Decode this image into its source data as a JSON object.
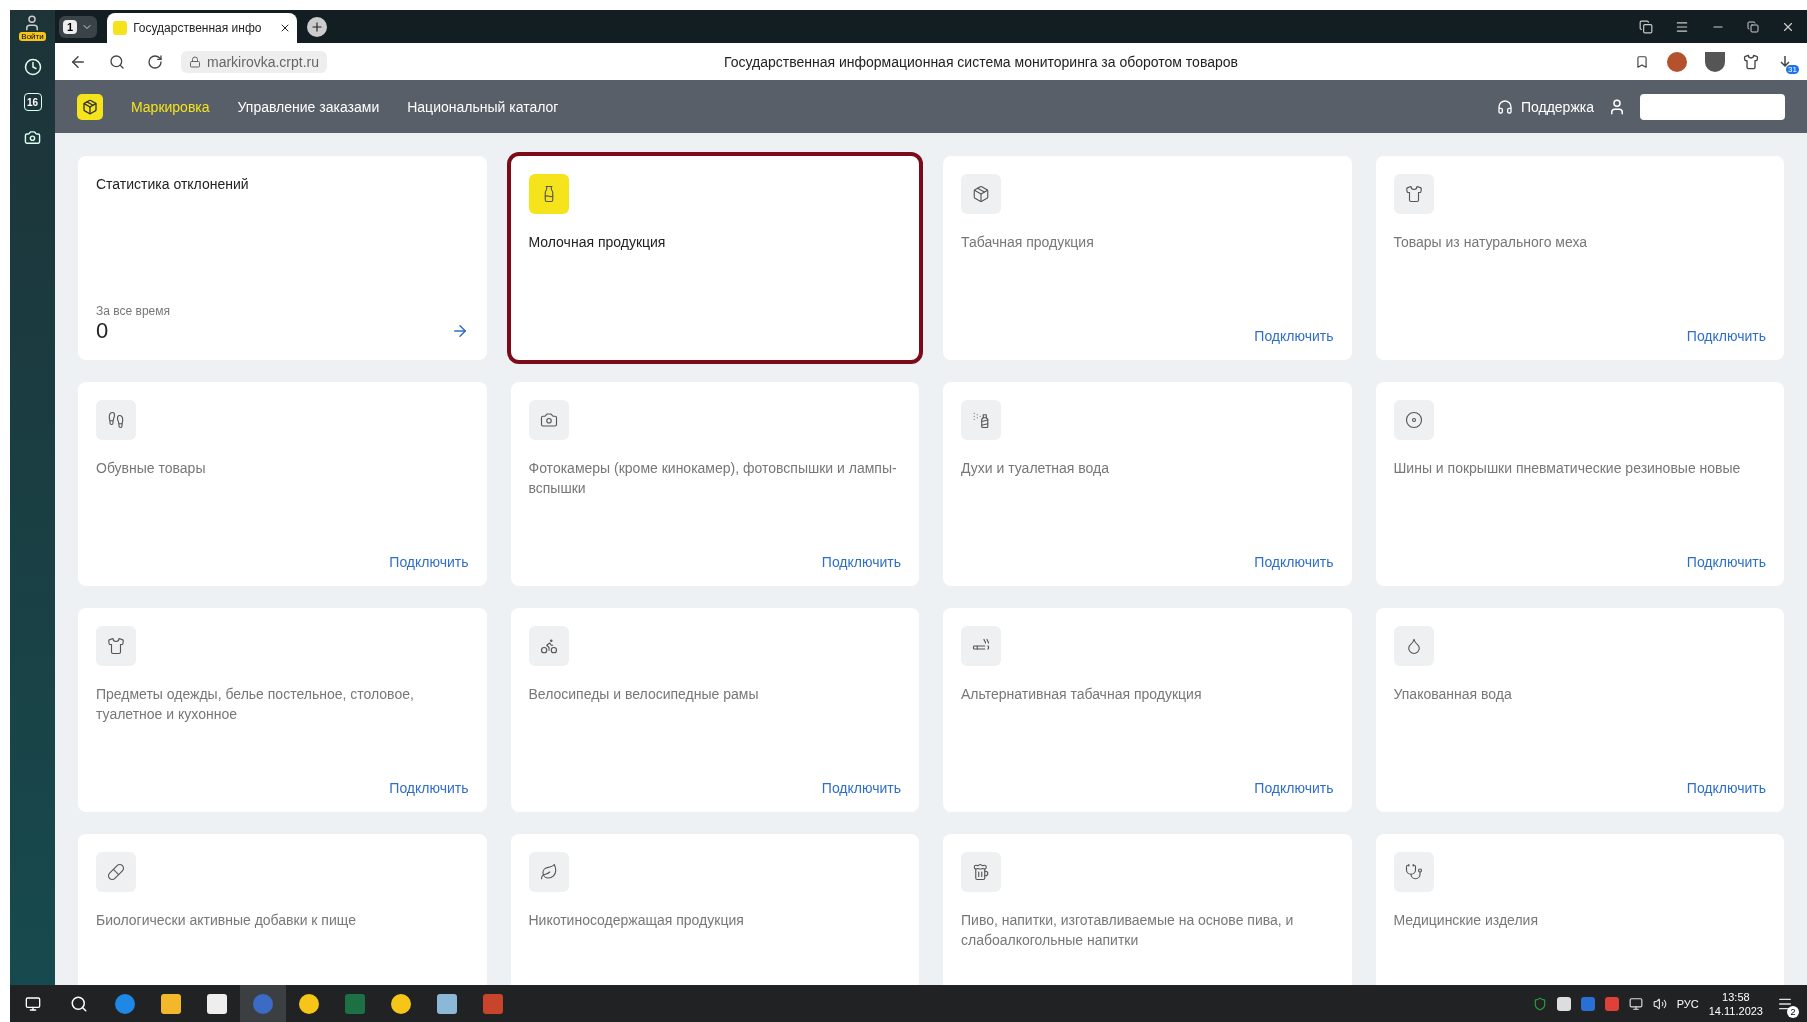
{
  "browser": {
    "profile_label": "Войти",
    "tab_count": "1",
    "tabs": [
      {
        "title": "Государственная инфо",
        "selected": true
      }
    ],
    "address": "markirovka.crpt.ru",
    "page_title": "Государственная информационная система мониторинга за оборотом товаров",
    "sidebar_badge": "16",
    "extension_badge": "31"
  },
  "header": {
    "nav": [
      {
        "label": "Маркировка",
        "selected": true
      },
      {
        "label": "Управление заказами",
        "selected": false
      },
      {
        "label": "Национальный каталог",
        "selected": false
      }
    ],
    "support": "Поддержка"
  },
  "cards": [
    {
      "kind": "stats",
      "title": "Статистика отклонений",
      "caption": "За все время",
      "value": "0"
    },
    {
      "kind": "product",
      "title": "Молочная продукция",
      "selected": true
    },
    {
      "kind": "product",
      "title": "Табачная продукция",
      "selected": false,
      "action": "Подключить"
    },
    {
      "kind": "product",
      "title": "Товары из натурального меха",
      "selected": false,
      "action": "Подключить"
    },
    {
      "kind": "product",
      "title": "Обувные товары",
      "selected": false,
      "action": "Подключить"
    },
    {
      "kind": "product",
      "title": "Фотокамеры (кроме кинокамер), фотовспышки и лампы-вспышки",
      "selected": false,
      "action": "Подключить"
    },
    {
      "kind": "product",
      "title": "Духи и туалетная вода",
      "selected": false,
      "action": "Подключить"
    },
    {
      "kind": "product",
      "title": "Шины и покрышки пневматические резиновые новые",
      "selected": false,
      "action": "Подключить"
    },
    {
      "kind": "product",
      "title": "Предметы одежды, белье постельное, столовое, туалетное и кухонное",
      "selected": false,
      "action": "Подключить"
    },
    {
      "kind": "product",
      "title": "Велосипеды и велосипедные рамы",
      "selected": false,
      "action": "Подключить"
    },
    {
      "kind": "product",
      "title": "Альтернативная табачная продукция",
      "selected": false,
      "action": "Подключить"
    },
    {
      "kind": "product",
      "title": "Упакованная вода",
      "selected": false,
      "action": "Подключить"
    },
    {
      "kind": "product",
      "title": "Биологически активные добавки к пище",
      "selected": false
    },
    {
      "kind": "product",
      "title": "Никотиносодержащая продукция",
      "selected": false
    },
    {
      "kind": "product",
      "title": "Пиво, напитки, изготавливаемые на основе пива, и слабоалкогольные напитки",
      "selected": false
    },
    {
      "kind": "product",
      "title": "Медицинские изделия",
      "selected": false
    }
  ],
  "taskbar": {
    "language": "РУС",
    "time": "13:58",
    "date": "14.11.2023",
    "notification_count": "2"
  }
}
